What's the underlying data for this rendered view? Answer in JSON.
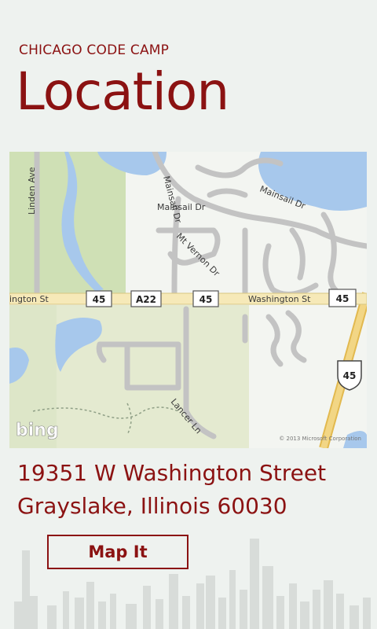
{
  "header": {
    "app_title": "CHICAGO CODE CAMP",
    "page_title": "Location"
  },
  "map": {
    "roads": {
      "linden": "Linden Ave",
      "mainsail_dr_1": "Mainsail Dr",
      "mainsail_dr_2": "Mainsail Dr",
      "mainsail_dr_3": "Mainsail Dr",
      "mt_vernon": "Mt Vernon Dr",
      "washington_left": "ington St",
      "washington_right": "Washington St",
      "lancer": "Lancer Ln"
    },
    "shields": {
      "route45_a": "45",
      "a22": "A22",
      "route45_b": "45",
      "route45_c": "45",
      "us45": "45"
    },
    "brand": "bing",
    "copyright": "© 2013 Microsoft Corporation"
  },
  "address": {
    "line1": "19351 W Washington Street",
    "line2": "Grayslake, Illinois 60030"
  },
  "actions": {
    "map_it_label": "Map It"
  },
  "colors": {
    "accent": "#8b1212",
    "background": "#eef2ef",
    "water": "#a7c8ec",
    "park": "#d3e2bc"
  }
}
